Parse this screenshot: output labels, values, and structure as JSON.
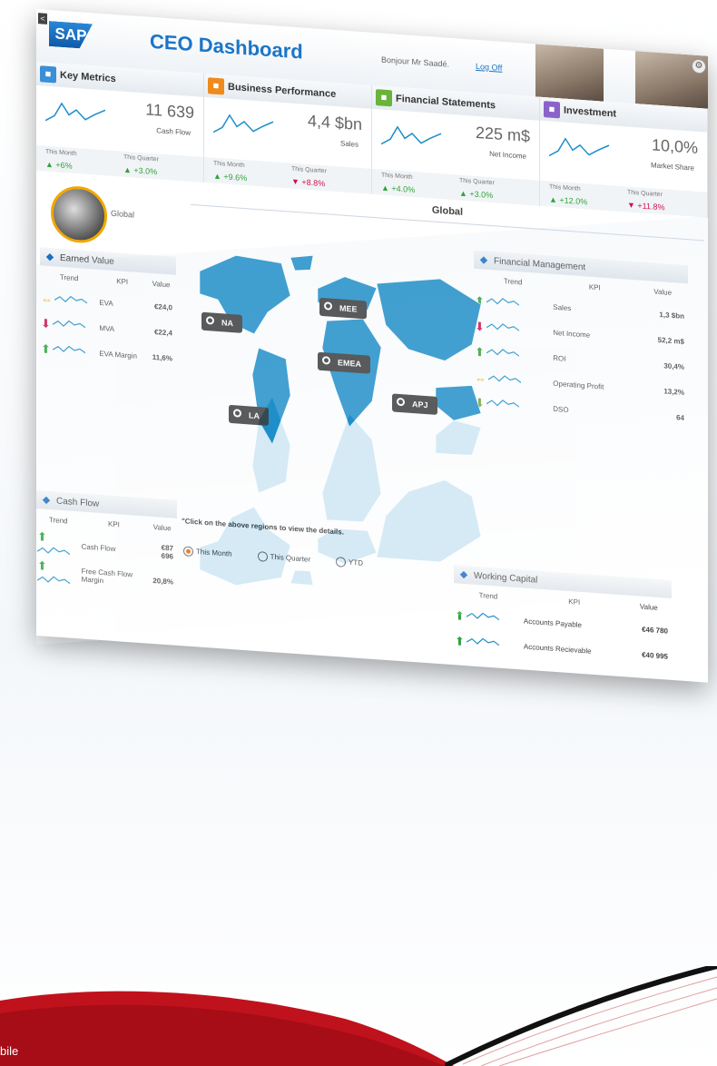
{
  "header": {
    "logo": "SAP",
    "back": "<",
    "title": "CEO Dashboard",
    "greeting": "Bonjour Mr Saadé.",
    "logoff": "Log Off",
    "settings": "⚙"
  },
  "kpis": [
    {
      "title": "Key Metrics",
      "value": "11 639",
      "sub": "Cash Flow",
      "month_label": "This Month",
      "month_value": "+6%",
      "month_dir": "up",
      "quarter_label": "This Quarter",
      "quarter_value": "+3.0%",
      "quarter_dir": "up",
      "icon": "chart-icon",
      "color": "#3b8fd6"
    },
    {
      "title": "Business Performance",
      "value": "4,4 $bn",
      "sub": "Sales",
      "month_label": "This Month",
      "month_value": "+9.6%",
      "month_dir": "up",
      "quarter_label": "This Quarter",
      "quarter_value": "+8.8%",
      "quarter_dir": "down",
      "icon": "clock-icon",
      "color": "#ef8a1c"
    },
    {
      "title": "Financial Statements",
      "value": "225 m$",
      "sub": "Net Income",
      "month_label": "This Month",
      "month_value": "+4.0%",
      "month_dir": "up",
      "quarter_label": "This Quarter",
      "quarter_value": "+3.0%",
      "quarter_dir": "up",
      "icon": "document-icon",
      "color": "#69b43a"
    },
    {
      "title": "Investment",
      "value": "10,0%",
      "sub": "Market Share",
      "month_label": "This Month",
      "month_value": "+12.0%",
      "month_dir": "up",
      "quarter_label": "This Quarter",
      "quarter_value": "+11.8%",
      "quarter_dir": "down",
      "icon": "building-icon",
      "color": "#8a63c9"
    }
  ],
  "global": {
    "badge_label": "Global",
    "section_title": "Global"
  },
  "earned_value": {
    "title": "Earned Value",
    "headers": [
      "Trend",
      "KPI",
      "Value"
    ],
    "rows": [
      {
        "dir": "both",
        "kpi": "EVA",
        "value": "€24,0"
      },
      {
        "dir": "down",
        "kpi": "MVA",
        "value": "€22,4"
      },
      {
        "dir": "up",
        "kpi": "EVA Margin",
        "value": "11,6%"
      }
    ]
  },
  "cash_flow": {
    "title": "Cash Flow",
    "headers": [
      "Trend",
      "KPI",
      "Value"
    ],
    "rows": [
      {
        "dir": "up",
        "kpi": "Cash Flow",
        "value": "€87 696"
      },
      {
        "dir": "up",
        "kpi": "Free Cash Flow Margin",
        "value": "20,8%"
      }
    ]
  },
  "financial_management": {
    "title": "Financial Management",
    "headers": [
      "Trend",
      "KPI",
      "Value"
    ],
    "rows": [
      {
        "dir": "up",
        "kpi": "Sales",
        "value": "1,3 $bn"
      },
      {
        "dir": "down",
        "kpi": "Net Income",
        "value": "52,2 m$"
      },
      {
        "dir": "up",
        "kpi": "ROI",
        "value": "30,4%"
      },
      {
        "dir": "both",
        "kpi": "Operating Profit",
        "value": "13,2%"
      },
      {
        "dir": "down-green",
        "kpi": "DSO",
        "value": "64"
      }
    ]
  },
  "working_capital": {
    "title": "Working Capital",
    "headers": [
      "Trend",
      "KPI",
      "Value"
    ],
    "rows": [
      {
        "dir": "up",
        "kpi": "Accounts Payable",
        "value": "€46 780"
      },
      {
        "dir": "up",
        "kpi": "Accounts Recievable",
        "value": "€40 995"
      }
    ]
  },
  "map": {
    "regions": [
      {
        "id": "na",
        "label": "NA"
      },
      {
        "id": "mee",
        "label": "MEE"
      },
      {
        "id": "emea",
        "label": "EMEA"
      },
      {
        "id": "apj",
        "label": "APJ"
      },
      {
        "id": "la",
        "label": "LA"
      }
    ],
    "hint": "\"Click on the above regions to view the details.",
    "land_color": "#1f8fc9"
  },
  "period": {
    "options": [
      "This Month",
      "This Quarter",
      "YTD"
    ],
    "selected": "This Month"
  },
  "footer": {
    "text": "bile"
  },
  "colors": {
    "accent": "#1a75c8",
    "up": "#2fa33c",
    "down": "#d0104c",
    "both": "#f0a800",
    "brand_red": "#c0121c"
  }
}
